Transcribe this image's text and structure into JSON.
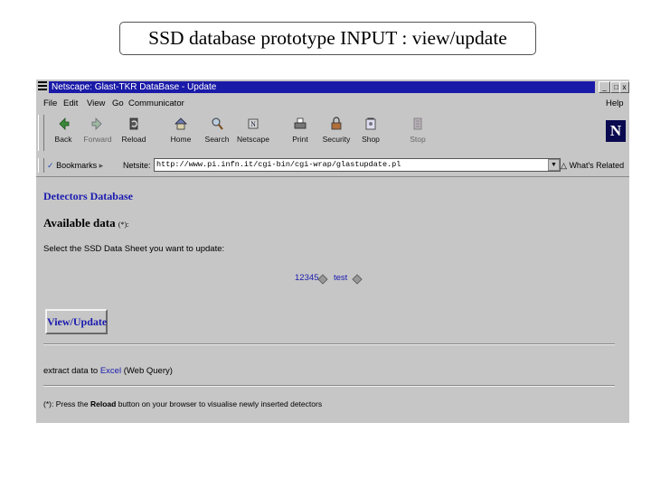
{
  "slide": {
    "title": "SSD database prototype INPUT : view/update"
  },
  "window": {
    "title": "Netscape: Glast-TKR DataBase - Update",
    "buttons": [
      "_",
      "□",
      "x"
    ]
  },
  "menubar": {
    "items": [
      "File",
      "Edit",
      "View",
      "Go",
      "Communicator"
    ],
    "help": "Help"
  },
  "toolbar": {
    "buttons": [
      {
        "label": "Back",
        "icon": "back-arrow-icon",
        "enabled": true
      },
      {
        "label": "Forward",
        "icon": "forward-arrow-icon",
        "enabled": false
      },
      {
        "label": "Reload",
        "icon": "reload-icon",
        "enabled": true
      },
      {
        "label": "Home",
        "icon": "home-icon",
        "enabled": true
      },
      {
        "label": "Search",
        "icon": "search-icon",
        "enabled": true
      },
      {
        "label": "Netscape",
        "icon": "netscape-icon",
        "enabled": true
      },
      {
        "label": "Print",
        "icon": "print-icon",
        "enabled": true
      },
      {
        "label": "Security",
        "icon": "security-lock-icon",
        "enabled": true
      },
      {
        "label": "Shop",
        "icon": "shop-icon",
        "enabled": true
      },
      {
        "label": "Stop",
        "icon": "stop-icon",
        "enabled": false
      }
    ],
    "logo": "N"
  },
  "location": {
    "bookmarks_label": "Bookmarks",
    "netsite_label": "Netsite:",
    "url": "http://www.pi.infn.it/cgi-bin/cgi-wrap/glastupdate.pl",
    "whats_related": "What's Related"
  },
  "content": {
    "db_title": "Detectors Database",
    "available_heading": "Available data",
    "available_note": "(*):",
    "select_prompt": "Select the SSD Data Sheet you want to update:",
    "sheets": [
      "12345",
      "test"
    ],
    "view_update_button": "View/Update",
    "extract_prefix": "extract data to",
    "extract_link": "Excel",
    "extract_suffix": "(Web Query)",
    "footnote_prefix": "(*): Press the",
    "footnote_bold": "Reload",
    "footnote_suffix": "button on your browser to visualise newly inserted detectors"
  },
  "colors": {
    "titlebar": "#1a1aa8",
    "link": "#1a1ab0",
    "chrome": "#c6c6c6"
  }
}
